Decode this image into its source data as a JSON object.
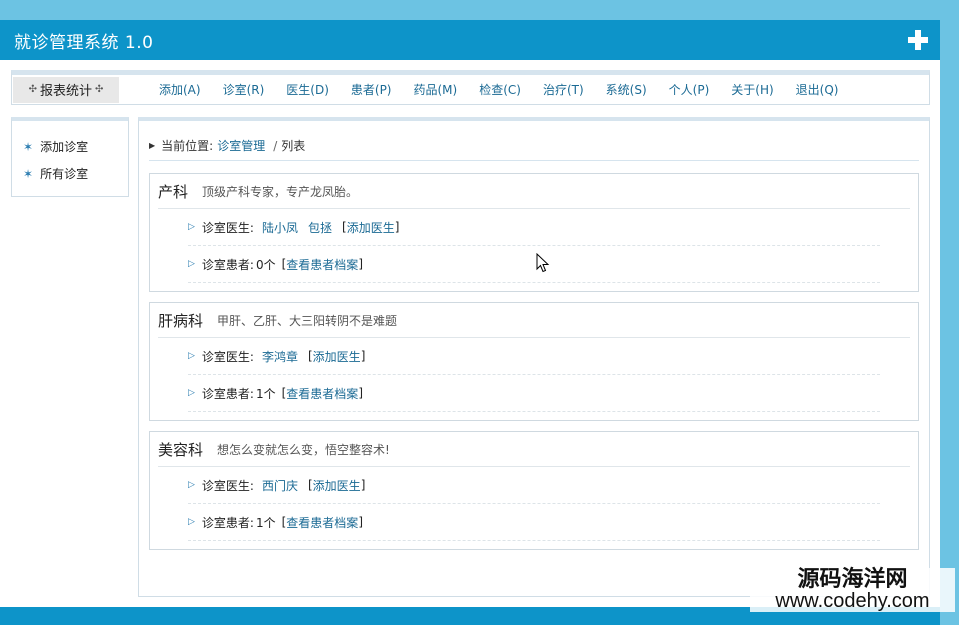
{
  "header": {
    "title": "就诊管理系统 1.0",
    "icon": "plus-icon"
  },
  "menubar": {
    "left_label": "报表统计",
    "items": [
      "添加(A)",
      "诊室(R)",
      "医生(D)",
      "患者(P)",
      "药品(M)",
      "检查(C)",
      "治疗(T)",
      "系统(S)",
      "个人(P)",
      "关于(H)",
      "退出(Q)"
    ]
  },
  "sidebar": {
    "items": [
      "添加诊室",
      "所有诊室"
    ]
  },
  "breadcrumb": {
    "prefix": "当前位置:",
    "link": "诊室管理",
    "sep": "/",
    "current": "列表"
  },
  "labels": {
    "doctors": "诊室医生:",
    "patients": "诊室患者:",
    "add_doctor": "添加医生",
    "view_records": "查看患者档案"
  },
  "departments": [
    {
      "name": "产科",
      "desc": "顶级产科专家，专产龙凤胎。",
      "doctors": [
        "陆小凤",
        "包拯"
      ],
      "patients": "0个"
    },
    {
      "name": "肝病科",
      "desc": "甲肝、乙肝、大三阳转阴不是难题",
      "doctors": [
        "李鸿章"
      ],
      "patients": "1个"
    },
    {
      "name": "美容科",
      "desc": "想怎么变就怎么变，悟空整容术!",
      "doctors": [
        "西门庆"
      ],
      "patients": "1个"
    }
  ],
  "watermark": {
    "cn": "源码海洋网",
    "en": "www.codehy.com"
  }
}
